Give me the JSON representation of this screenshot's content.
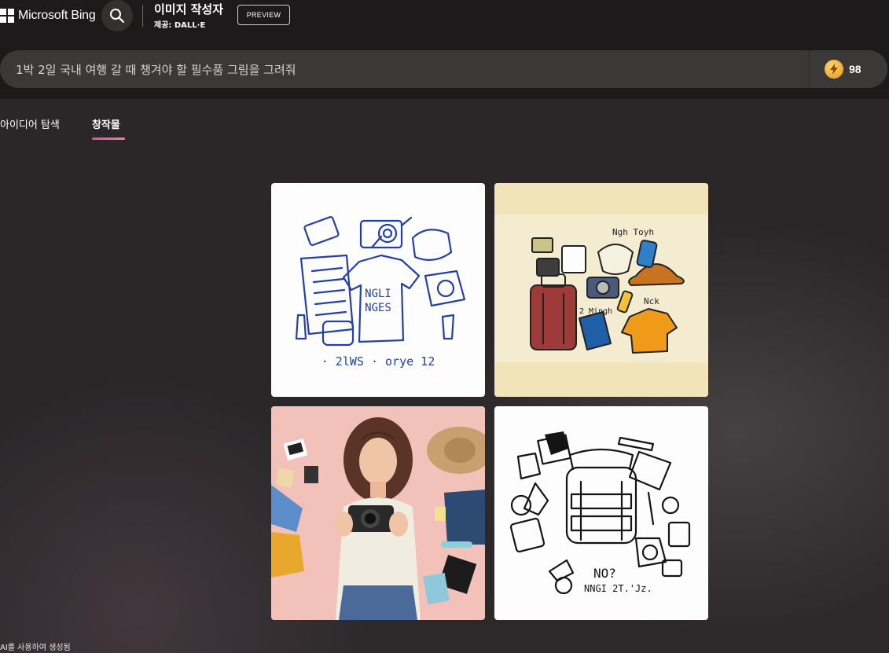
{
  "header": {
    "brand": "Microsoft Bing",
    "title": "이미지 작성자",
    "subtitle": "제공: DALL·E",
    "preview_label": "PREVIEW"
  },
  "prompt": {
    "value": "1박 2일 국내 여행 갈 때 챙겨야 할 필수품 그림을 그려줘",
    "boosts": "98"
  },
  "tabs": [
    {
      "label": "아이디어 탐색",
      "active": false
    },
    {
      "label": "창작물",
      "active": true
    }
  ],
  "images": {
    "img1_text_a": "NGLI",
    "img1_text_b": "NGES",
    "img1_caption": "· 2lWS · orye 12",
    "img2_text_a": "Ngh Toyh",
    "img2_text_b": "2 Mingh",
    "img2_text_c": "Nck",
    "img4_text_a": "NO?",
    "img4_text_b": "NNGI 2T.'Jz."
  },
  "footer": {
    "note": "AI를 사용하여 생성됨"
  },
  "colors": {
    "accent_tab": "#e0548a",
    "background": "#1f1c1d",
    "prompt_bar": "#3b3838"
  }
}
